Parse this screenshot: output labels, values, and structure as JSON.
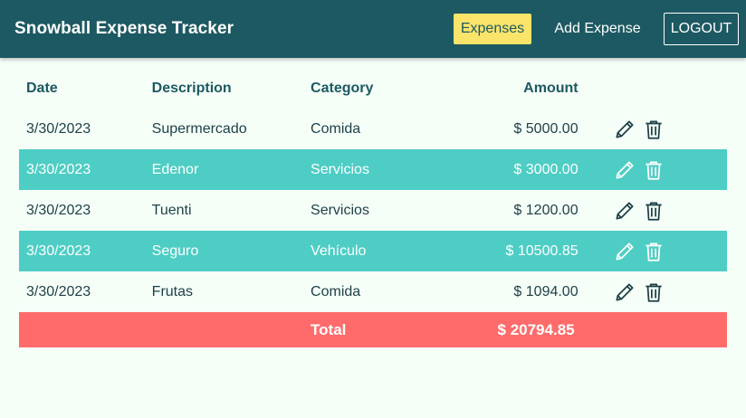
{
  "header": {
    "brand": "Snowball Expense Tracker",
    "nav": {
      "expenses": "Expenses",
      "add_expense": "Add Expense",
      "logout": "LOGOUT"
    }
  },
  "table": {
    "columns": {
      "date": "Date",
      "description": "Description",
      "category": "Category",
      "amount": "Amount"
    },
    "rows": [
      {
        "date": "3/30/2023",
        "description": "Supermercado",
        "category": "Comida",
        "amount": "$ 5000.00"
      },
      {
        "date": "3/30/2023",
        "description": "Edenor",
        "category": "Servicios",
        "amount": "$ 3000.00"
      },
      {
        "date": "3/30/2023",
        "description": "Tuenti",
        "category": "Servicios",
        "amount": "$ 1200.00"
      },
      {
        "date": "3/30/2023",
        "description": "Seguro",
        "category": "Vehículo",
        "amount": "$ 10500.85"
      },
      {
        "date": "3/30/2023",
        "description": "Frutas",
        "category": "Comida",
        "amount": "$ 1094.00"
      }
    ],
    "total": {
      "label": "Total",
      "amount": "$ 20794.85"
    }
  },
  "icons": {
    "edit": "pencil-icon",
    "delete": "trash-icon"
  },
  "colors": {
    "navbar": "#1d5962",
    "active_nav": "#fbe46a",
    "row_alt": "#4ecdc4",
    "total_row": "#ff6b6b",
    "background": "#f5fff7"
  }
}
